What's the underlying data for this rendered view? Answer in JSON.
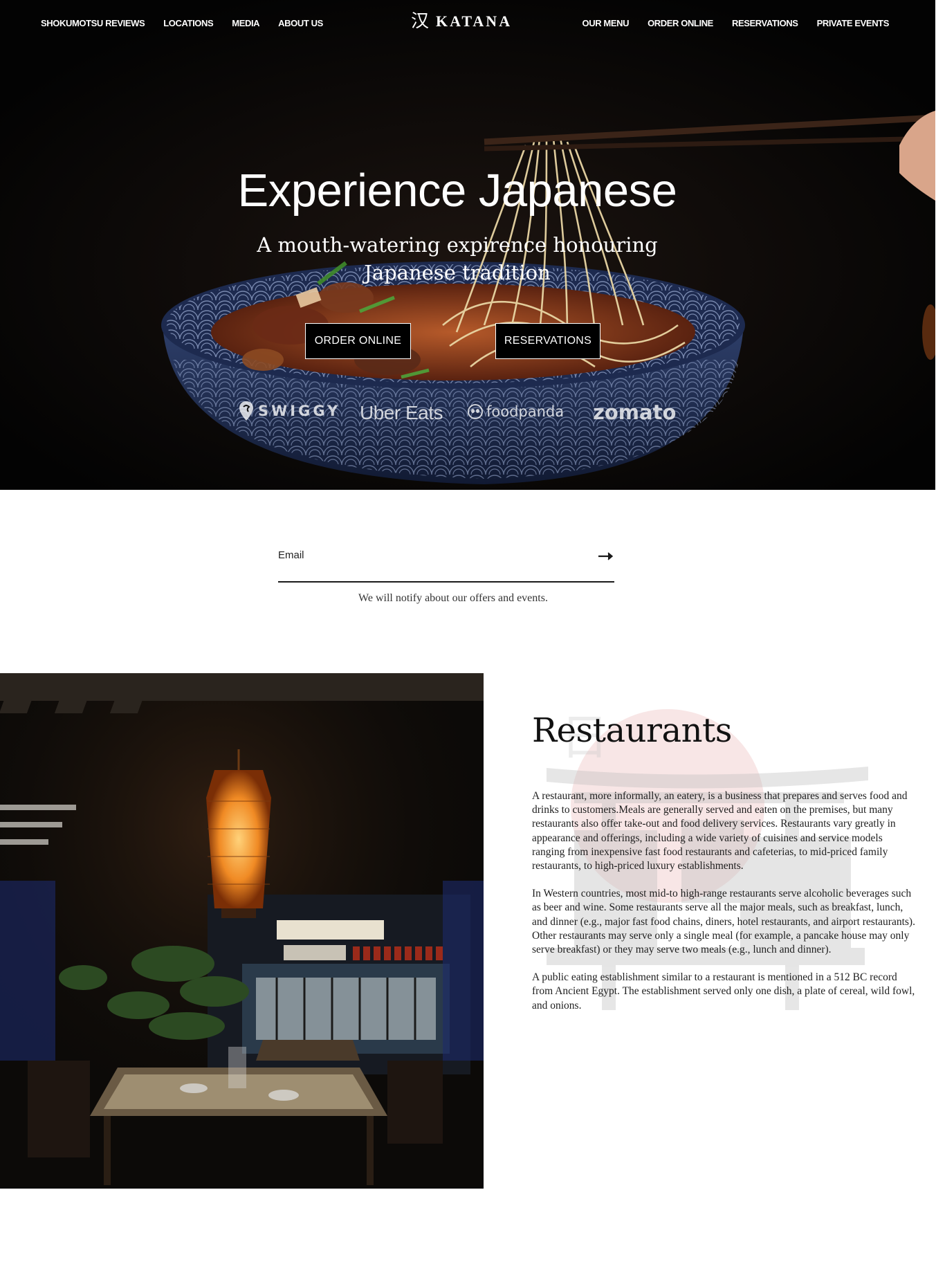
{
  "nav": {
    "left": [
      "SHOKUMOTSU REVIEWS",
      "LOCATIONS",
      "MEDIA",
      "ABOUT US"
    ],
    "right": [
      "OUR MENU",
      "ORDER ONLINE",
      "RESERVATIONS",
      "PRIVATE EVENTS"
    ],
    "logo_glyph": "汉",
    "logo_text": "KATANA"
  },
  "hero": {
    "title": "Experience Japanese",
    "subtitle_line1": "A mouth-watering expirence honouring",
    "subtitle_line2": "Japanese tradition",
    "order_button": "ORDER ONLINE",
    "reservations_button": "RESERVATIONS",
    "partners": [
      "SWIGGY",
      "Uber Eats",
      "foodpanda",
      "zomato"
    ]
  },
  "newsletter": {
    "placeholder": "Email",
    "note": "We will notify about our offers and events.",
    "submit_icon": "arrow-right-icon"
  },
  "restaurants": {
    "title": "Restaurants",
    "paragraphs": [
      "A restaurant, more informally, an eatery, is a business that prepares and serves food and drinks to customers.Meals are generally served and eaten on the premises, but many restaurants also offer take-out and food delivery services. Restaurants vary greatly in appearance and offerings, including a wide variety of cuisines and service models ranging from inexpensive fast food restaurants and cafeterias, to mid-priced family restaurants, to high-priced luxury establishments.",
      "In Western countries, most mid-to high-range restaurants serve alcoholic beverages such as beer and wine. Some restaurants serve all the major meals, such as breakfast, lunch, and dinner (e.g., major fast food chains, diners, hotel restaurants, and airport restaurants). Other restaurants may serve only a single meal (for example, a pancake house may only serve breakfast) or they may serve two meals (e.g., lunch and dinner).",
      "A public eating establishment similar to a restaurant is mentioned in a 512 BC record from Ancient Egypt. The establishment served only one dish, a plate of cereal, wild fowl, and onions."
    ],
    "watermark_glyph": "日"
  },
  "colors": {
    "hero_bg": "#050505",
    "text_dark": "#1a1a1a",
    "watermark_red": "#c93a3a"
  }
}
